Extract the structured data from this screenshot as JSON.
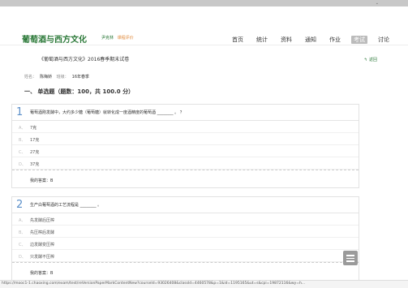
{
  "topbar": {
    "dropdown": "⌄"
  },
  "header": {
    "logo": "葡萄酒与西方文化",
    "teacher": "尹克林",
    "evaluate": "课程评价",
    "nav": [
      "首页",
      "统计",
      "资料",
      "通知",
      "作业",
      "考试",
      "讨论"
    ],
    "active_nav": "考试"
  },
  "exam": {
    "title": "《葡萄酒与西方文化》2016春季期末试卷",
    "back": "返回",
    "name_label": "姓名：",
    "name_value": "陈梅娇",
    "class_label": "班级：",
    "class_value": "16年春季",
    "section": "一、 单选题（题数：100，共 100.0 分）"
  },
  "questions": [
    {
      "num": "1",
      "text": "葡萄酒刚发酵中，大约多少糖（葡萄糖）就转化成一度酒精度的葡萄酒 ________ 。 ？",
      "options": [
        {
          "letter": "A、",
          "text": "7克"
        },
        {
          "letter": "B、",
          "text": "17克"
        },
        {
          "letter": "C、",
          "text": "27克"
        },
        {
          "letter": "D、",
          "text": "37克"
        }
      ],
      "answer": "我的答案：B"
    },
    {
      "num": "2",
      "text": "生产白葡萄酒的工艺流程是 ________ 。",
      "options": [
        {
          "letter": "A、",
          "text": "先发酵后压榨"
        },
        {
          "letter": "B、",
          "text": "先压榨后发酵"
        },
        {
          "letter": "C、",
          "text": "边发酵变压榨"
        },
        {
          "letter": "D、",
          "text": "只发酵不压榨"
        }
      ],
      "answer": "我的答案：B"
    }
  ],
  "statusbar": {
    "url": "https://mooc1-1.chaoxing.com/exam/test/reVersionPaperMarkContentNew?courseId=93026408&classId=4460578&p=1&id=1195165&ut=s&cpi=19872116&wy=h..."
  }
}
